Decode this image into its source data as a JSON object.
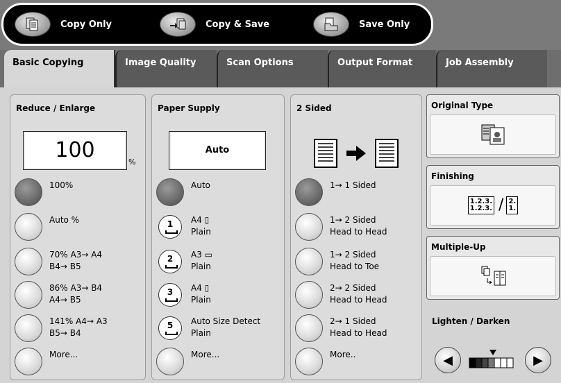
{
  "modes": [
    {
      "label": "Copy Only",
      "icon": "copy-only-icon"
    },
    {
      "label": "Copy & Save",
      "icon": "copy-save-icon"
    },
    {
      "label": "Save Only",
      "icon": "save-only-icon"
    }
  ],
  "tabs": [
    {
      "label": "Basic Copying"
    },
    {
      "label": "Image Quality"
    },
    {
      "label": "Scan Options"
    },
    {
      "label": "Output Format"
    },
    {
      "label": "Job Assembly"
    }
  ],
  "reduce_enlarge": {
    "title": "Reduce / Enlarge",
    "value": "100",
    "unit": "%",
    "options": [
      {
        "line1": "100%",
        "line2": ""
      },
      {
        "line1": "Auto %",
        "line2": ""
      },
      {
        "line1": "70% A3→ A4",
        "line2": "B4→ B5"
      },
      {
        "line1": "86% A3→ B4",
        "line2": "A4→ B5"
      },
      {
        "line1": "141% A4→ A3",
        "line2": "B5→ B4"
      },
      {
        "line1": "More...",
        "line2": ""
      }
    ]
  },
  "paper_supply": {
    "title": "Paper Supply",
    "value": "Auto",
    "options": [
      {
        "line1": "Auto",
        "line2": "",
        "tray": ""
      },
      {
        "line1": "A4",
        "line2": "Plain",
        "tray": "1"
      },
      {
        "line1": "A3",
        "line2": "Plain",
        "tray": "2"
      },
      {
        "line1": "A4",
        "line2": "Plain",
        "tray": "3"
      },
      {
        "line1": "Auto Size Detect",
        "line2": "Plain",
        "tray": "5"
      },
      {
        "line1": "More...",
        "line2": "",
        "tray": ""
      }
    ]
  },
  "two_sided": {
    "title": "2 Sided",
    "options": [
      {
        "line1": "1→ 1 Sided",
        "line2": ""
      },
      {
        "line1": "1→ 2 Sided",
        "line2": "Head to Head"
      },
      {
        "line1": "1→ 2 Sided",
        "line2": "Head to Toe"
      },
      {
        "line1": "2→ 2 Sided",
        "line2": "Head to Head"
      },
      {
        "line1": "2→ 1 Sided",
        "line2": "Head to Head"
      },
      {
        "line1": "More..",
        "line2": ""
      }
    ]
  },
  "side": {
    "original_type": "Original Type",
    "finishing": "Finishing",
    "finishing_icon_text_1": "1.2.3.",
    "finishing_icon_text_2": "1.2.3.",
    "finishing_icon_text_3": "2.",
    "finishing_icon_text_4": "1.",
    "multiple_up": "Multiple-Up",
    "lighten_darken": "Lighten / Darken"
  },
  "lighten_darken_level": 4,
  "colors": {
    "frame": "#6e6e6e",
    "panel": "#dcdcdc",
    "active_tab": "#d7d7d7"
  }
}
